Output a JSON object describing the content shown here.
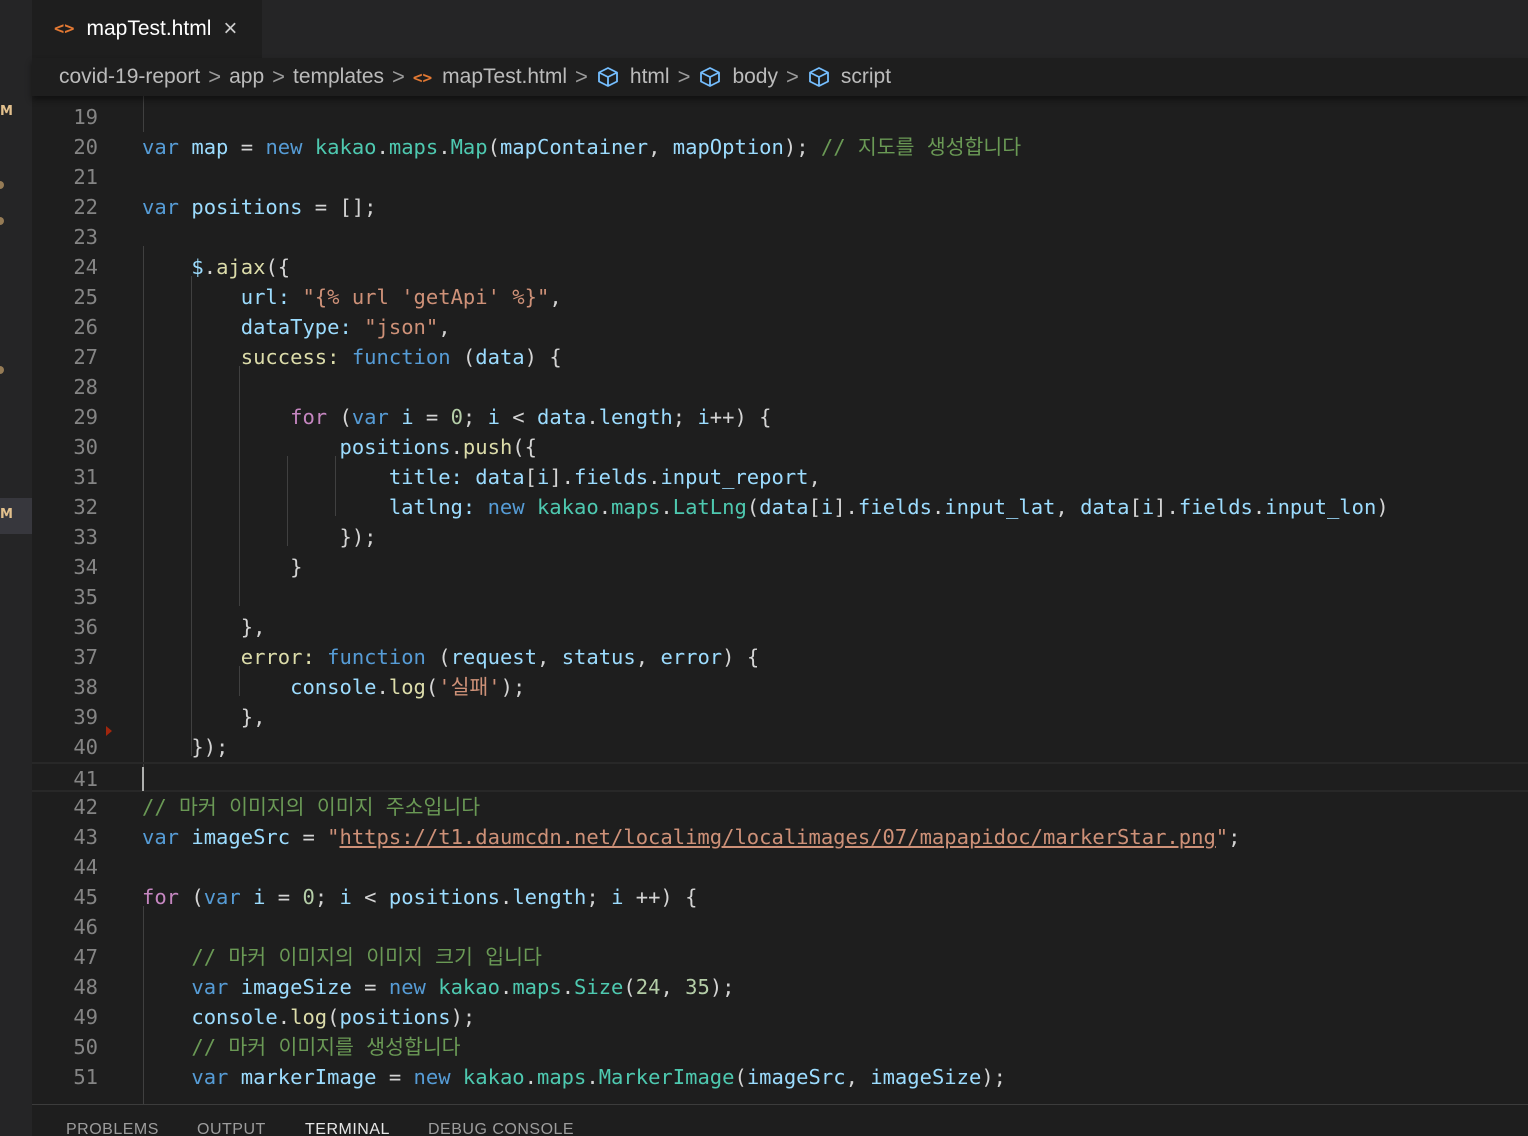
{
  "tab": {
    "icon": "<>",
    "label": "mapTest.html",
    "close": "×"
  },
  "breadcrumb": {
    "items": [
      "covid-19-report",
      "app",
      "templates",
      "mapTest.html",
      "html",
      "body",
      "script"
    ],
    "sep": ">",
    "file_icon": "<>"
  },
  "activity_bar": {
    "badges": [
      "M",
      "M"
    ]
  },
  "editor": {
    "lines": [
      {
        "n": "19",
        "tokens": []
      },
      {
        "n": "20",
        "tokens": [
          {
            "c": "kw",
            "t": "var"
          },
          {
            "c": "p",
            "t": " "
          },
          {
            "c": "var",
            "t": "map"
          },
          {
            "c": "p",
            "t": " = "
          },
          {
            "c": "kw",
            "t": "new"
          },
          {
            "c": "p",
            "t": " "
          },
          {
            "c": "cls",
            "t": "kakao"
          },
          {
            "c": "p",
            "t": "."
          },
          {
            "c": "cls",
            "t": "maps"
          },
          {
            "c": "p",
            "t": "."
          },
          {
            "c": "cls",
            "t": "Map"
          },
          {
            "c": "p",
            "t": "("
          },
          {
            "c": "var",
            "t": "mapContainer"
          },
          {
            "c": "p",
            "t": ", "
          },
          {
            "c": "var",
            "t": "mapOption"
          },
          {
            "c": "p",
            "t": "); "
          },
          {
            "c": "cm",
            "t": "// 지도를 생성합니다"
          }
        ]
      },
      {
        "n": "21",
        "tokens": []
      },
      {
        "n": "22",
        "tokens": [
          {
            "c": "kw",
            "t": "var"
          },
          {
            "c": "p",
            "t": " "
          },
          {
            "c": "var",
            "t": "positions"
          },
          {
            "c": "p",
            "t": " = [];"
          }
        ]
      },
      {
        "n": "23",
        "tokens": []
      },
      {
        "n": "24",
        "tokens": [
          {
            "c": "p",
            "t": "    "
          },
          {
            "c": "var",
            "t": "$"
          },
          {
            "c": "p",
            "t": "."
          },
          {
            "c": "fn",
            "t": "ajax"
          },
          {
            "c": "p",
            "t": "({"
          }
        ]
      },
      {
        "n": "25",
        "tokens": [
          {
            "c": "p",
            "t": "        "
          },
          {
            "c": "var",
            "t": "url:"
          },
          {
            "c": "p",
            "t": " "
          },
          {
            "c": "str",
            "t": "\"{% url 'getApi' %}\""
          },
          {
            "c": "p",
            "t": ","
          }
        ]
      },
      {
        "n": "26",
        "tokens": [
          {
            "c": "p",
            "t": "        "
          },
          {
            "c": "var",
            "t": "dataType:"
          },
          {
            "c": "p",
            "t": " "
          },
          {
            "c": "str",
            "t": "\"json\""
          },
          {
            "c": "p",
            "t": ","
          }
        ]
      },
      {
        "n": "27",
        "tokens": [
          {
            "c": "p",
            "t": "        "
          },
          {
            "c": "fn",
            "t": "success:"
          },
          {
            "c": "p",
            "t": " "
          },
          {
            "c": "kw",
            "t": "function"
          },
          {
            "c": "p",
            "t": " ("
          },
          {
            "c": "var",
            "t": "data"
          },
          {
            "c": "p",
            "t": ") {"
          }
        ]
      },
      {
        "n": "28",
        "tokens": []
      },
      {
        "n": "29",
        "tokens": [
          {
            "c": "p",
            "t": "            "
          },
          {
            "c": "ctl",
            "t": "for"
          },
          {
            "c": "p",
            "t": " ("
          },
          {
            "c": "kw",
            "t": "var"
          },
          {
            "c": "p",
            "t": " "
          },
          {
            "c": "var",
            "t": "i"
          },
          {
            "c": "p",
            "t": " = "
          },
          {
            "c": "num",
            "t": "0"
          },
          {
            "c": "p",
            "t": "; "
          },
          {
            "c": "var",
            "t": "i"
          },
          {
            "c": "p",
            "t": " < "
          },
          {
            "c": "var",
            "t": "data"
          },
          {
            "c": "p",
            "t": "."
          },
          {
            "c": "var",
            "t": "length"
          },
          {
            "c": "p",
            "t": "; "
          },
          {
            "c": "var",
            "t": "i"
          },
          {
            "c": "p",
            "t": "++) {"
          }
        ]
      },
      {
        "n": "30",
        "tokens": [
          {
            "c": "p",
            "t": "                "
          },
          {
            "c": "var",
            "t": "positions"
          },
          {
            "c": "p",
            "t": "."
          },
          {
            "c": "fn",
            "t": "push"
          },
          {
            "c": "p",
            "t": "({"
          }
        ]
      },
      {
        "n": "31",
        "tokens": [
          {
            "c": "p",
            "t": "                    "
          },
          {
            "c": "var",
            "t": "title:"
          },
          {
            "c": "p",
            "t": " "
          },
          {
            "c": "var",
            "t": "data"
          },
          {
            "c": "p",
            "t": "["
          },
          {
            "c": "var",
            "t": "i"
          },
          {
            "c": "p",
            "t": "]."
          },
          {
            "c": "var",
            "t": "fields"
          },
          {
            "c": "p",
            "t": "."
          },
          {
            "c": "var",
            "t": "input_report"
          },
          {
            "c": "p",
            "t": ","
          }
        ]
      },
      {
        "n": "32",
        "tokens": [
          {
            "c": "p",
            "t": "                    "
          },
          {
            "c": "var",
            "t": "latlng:"
          },
          {
            "c": "p",
            "t": " "
          },
          {
            "c": "kw",
            "t": "new"
          },
          {
            "c": "p",
            "t": " "
          },
          {
            "c": "cls",
            "t": "kakao"
          },
          {
            "c": "p",
            "t": "."
          },
          {
            "c": "cls",
            "t": "maps"
          },
          {
            "c": "p",
            "t": "."
          },
          {
            "c": "cls",
            "t": "LatLng"
          },
          {
            "c": "p",
            "t": "("
          },
          {
            "c": "var",
            "t": "data"
          },
          {
            "c": "p",
            "t": "["
          },
          {
            "c": "var",
            "t": "i"
          },
          {
            "c": "p",
            "t": "]."
          },
          {
            "c": "var",
            "t": "fields"
          },
          {
            "c": "p",
            "t": "."
          },
          {
            "c": "var",
            "t": "input_lat"
          },
          {
            "c": "p",
            "t": ", "
          },
          {
            "c": "var",
            "t": "data"
          },
          {
            "c": "p",
            "t": "["
          },
          {
            "c": "var",
            "t": "i"
          },
          {
            "c": "p",
            "t": "]."
          },
          {
            "c": "var",
            "t": "fields"
          },
          {
            "c": "p",
            "t": "."
          },
          {
            "c": "var",
            "t": "input_lon"
          },
          {
            "c": "p",
            "t": ")"
          }
        ]
      },
      {
        "n": "33",
        "tokens": [
          {
            "c": "p",
            "t": "                });"
          }
        ]
      },
      {
        "n": "34",
        "tokens": [
          {
            "c": "p",
            "t": "            }"
          }
        ]
      },
      {
        "n": "35",
        "tokens": []
      },
      {
        "n": "36",
        "tokens": [
          {
            "c": "p",
            "t": "        },"
          }
        ]
      },
      {
        "n": "37",
        "tokens": [
          {
            "c": "p",
            "t": "        "
          },
          {
            "c": "fn",
            "t": "error:"
          },
          {
            "c": "p",
            "t": " "
          },
          {
            "c": "kw",
            "t": "function"
          },
          {
            "c": "p",
            "t": " ("
          },
          {
            "c": "var",
            "t": "request"
          },
          {
            "c": "p",
            "t": ", "
          },
          {
            "c": "var",
            "t": "status"
          },
          {
            "c": "p",
            "t": ", "
          },
          {
            "c": "var",
            "t": "error"
          },
          {
            "c": "p",
            "t": ") {"
          }
        ]
      },
      {
        "n": "38",
        "tokens": [
          {
            "c": "p",
            "t": "            "
          },
          {
            "c": "var",
            "t": "console"
          },
          {
            "c": "p",
            "t": "."
          },
          {
            "c": "fn",
            "t": "log"
          },
          {
            "c": "p",
            "t": "("
          },
          {
            "c": "str",
            "t": "'실패'"
          },
          {
            "c": "p",
            "t": ");"
          }
        ]
      },
      {
        "n": "39",
        "tokens": [
          {
            "c": "p",
            "t": "        },"
          }
        ]
      },
      {
        "n": "40",
        "tokens": [
          {
            "c": "p",
            "t": "    });"
          }
        ]
      },
      {
        "n": "41",
        "tokens": []
      },
      {
        "n": "42",
        "tokens": [
          {
            "c": "cm",
            "t": "// 마커 이미지의 이미지 주소입니다"
          }
        ]
      },
      {
        "n": "43",
        "tokens": [
          {
            "c": "kw",
            "t": "var"
          },
          {
            "c": "p",
            "t": " "
          },
          {
            "c": "var",
            "t": "imageSrc"
          },
          {
            "c": "p",
            "t": " = "
          },
          {
            "c": "str",
            "t": "\""
          },
          {
            "c": "url",
            "t": "https://t1.daumcdn.net/localimg/localimages/07/mapapidoc/markerStar.png"
          },
          {
            "c": "str",
            "t": "\""
          },
          {
            "c": "p",
            "t": ";"
          }
        ]
      },
      {
        "n": "44",
        "tokens": []
      },
      {
        "n": "45",
        "tokens": [
          {
            "c": "ctl",
            "t": "for"
          },
          {
            "c": "p",
            "t": " ("
          },
          {
            "c": "kw",
            "t": "var"
          },
          {
            "c": "p",
            "t": " "
          },
          {
            "c": "var",
            "t": "i"
          },
          {
            "c": "p",
            "t": " = "
          },
          {
            "c": "num",
            "t": "0"
          },
          {
            "c": "p",
            "t": "; "
          },
          {
            "c": "var",
            "t": "i"
          },
          {
            "c": "p",
            "t": " < "
          },
          {
            "c": "var",
            "t": "positions"
          },
          {
            "c": "p",
            "t": "."
          },
          {
            "c": "var",
            "t": "length"
          },
          {
            "c": "p",
            "t": "; "
          },
          {
            "c": "var",
            "t": "i"
          },
          {
            "c": "p",
            "t": " ++) {"
          }
        ]
      },
      {
        "n": "46",
        "tokens": []
      },
      {
        "n": "47",
        "tokens": [
          {
            "c": "p",
            "t": "    "
          },
          {
            "c": "cm",
            "t": "// 마커 이미지의 이미지 크기 입니다"
          }
        ]
      },
      {
        "n": "48",
        "tokens": [
          {
            "c": "p",
            "t": "    "
          },
          {
            "c": "kw",
            "t": "var"
          },
          {
            "c": "p",
            "t": " "
          },
          {
            "c": "var",
            "t": "imageSize"
          },
          {
            "c": "p",
            "t": " = "
          },
          {
            "c": "kw",
            "t": "new"
          },
          {
            "c": "p",
            "t": " "
          },
          {
            "c": "cls",
            "t": "kakao"
          },
          {
            "c": "p",
            "t": "."
          },
          {
            "c": "cls",
            "t": "maps"
          },
          {
            "c": "p",
            "t": "."
          },
          {
            "c": "cls",
            "t": "Size"
          },
          {
            "c": "p",
            "t": "("
          },
          {
            "c": "num",
            "t": "24"
          },
          {
            "c": "p",
            "t": ", "
          },
          {
            "c": "num",
            "t": "35"
          },
          {
            "c": "p",
            "t": ");"
          }
        ]
      },
      {
        "n": "49",
        "tokens": [
          {
            "c": "p",
            "t": "    "
          },
          {
            "c": "var",
            "t": "console"
          },
          {
            "c": "p",
            "t": "."
          },
          {
            "c": "fn",
            "t": "log"
          },
          {
            "c": "p",
            "t": "("
          },
          {
            "c": "var",
            "t": "positions"
          },
          {
            "c": "p",
            "t": ");"
          }
        ]
      },
      {
        "n": "50",
        "tokens": [
          {
            "c": "p",
            "t": "    "
          },
          {
            "c": "cm",
            "t": "// 마커 이미지를 생성합니다"
          }
        ]
      },
      {
        "n": "51",
        "tokens": [
          {
            "c": "p",
            "t": "    "
          },
          {
            "c": "kw",
            "t": "var"
          },
          {
            "c": "p",
            "t": " "
          },
          {
            "c": "var",
            "t": "markerImage"
          },
          {
            "c": "p",
            "t": " = "
          },
          {
            "c": "kw",
            "t": "new"
          },
          {
            "c": "p",
            "t": " "
          },
          {
            "c": "cls",
            "t": "kakao"
          },
          {
            "c": "p",
            "t": "."
          },
          {
            "c": "cls",
            "t": "maps"
          },
          {
            "c": "p",
            "t": "."
          },
          {
            "c": "cls",
            "t": "MarkerImage"
          },
          {
            "c": "p",
            "t": "("
          },
          {
            "c": "var",
            "t": "imageSrc"
          },
          {
            "c": "p",
            "t": ", "
          },
          {
            "c": "var",
            "t": "imageSize"
          },
          {
            "c": "p",
            "t": ");"
          }
        ]
      }
    ]
  },
  "panel": {
    "tabs": [
      "PROBLEMS",
      "OUTPUT",
      "TERMINAL",
      "DEBUG CONSOLE"
    ],
    "active": "TERMINAL"
  },
  "colors": {
    "background": "#1e1e1e",
    "keyword": "#569cd6",
    "control": "#c586c0",
    "variable": "#9cdcfe",
    "function": "#dcdcaa",
    "class": "#4ec9b0",
    "string": "#ce9178",
    "number": "#b5cea8",
    "comment": "#6a9955"
  }
}
